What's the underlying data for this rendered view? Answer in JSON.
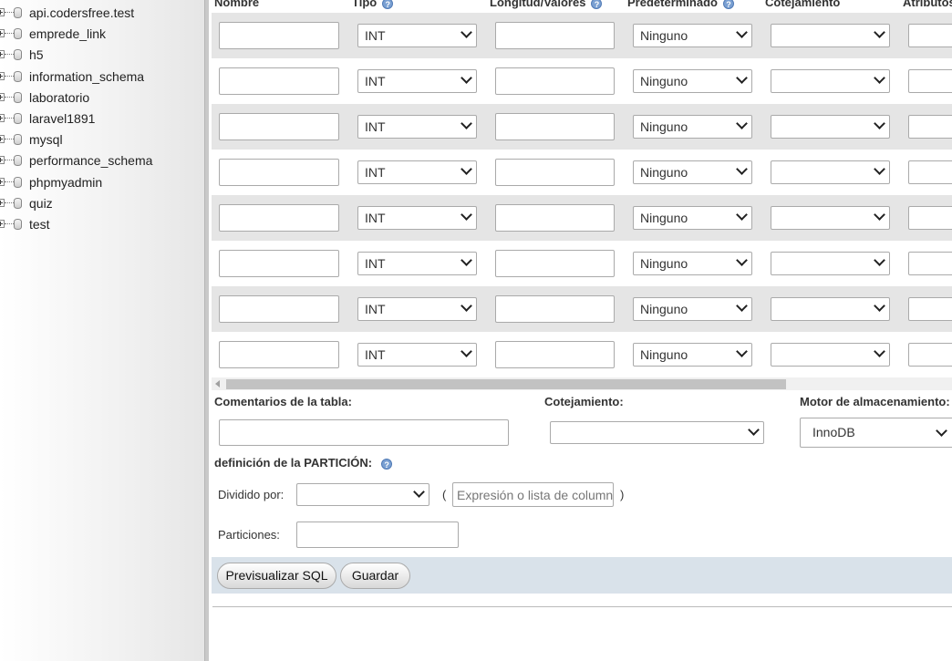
{
  "sidebar": {
    "databases": [
      "api.codersfree.test",
      "emprede_link",
      "h5",
      "information_schema",
      "laboratorio",
      "laravel1891",
      "mysql",
      "performance_schema",
      "phpmyadmin",
      "quiz",
      "test"
    ]
  },
  "columns": {
    "name": "Nombre",
    "type": "Tipo",
    "length": "Longitud/Valores",
    "default": "Predeterminado",
    "collation": "Cotejamiento",
    "attributes": "Atributos"
  },
  "rows": [
    {
      "type": "INT",
      "default": "Ninguno"
    },
    {
      "type": "INT",
      "default": "Ninguno"
    },
    {
      "type": "INT",
      "default": "Ninguno"
    },
    {
      "type": "INT",
      "default": "Ninguno"
    },
    {
      "type": "INT",
      "default": "Ninguno"
    },
    {
      "type": "INT",
      "default": "Ninguno"
    },
    {
      "type": "INT",
      "default": "Ninguno"
    },
    {
      "type": "INT",
      "default": "Ninguno"
    }
  ],
  "table_options": {
    "comments_label": "Comentarios de la tabla:",
    "collation_label": "Cotejamiento:",
    "engine_label": "Motor de almacenamiento:",
    "engine_value": "InnoDB"
  },
  "partition": {
    "title": "definición de la PARTICIÓN:",
    "divided_by_label": "Dividido por:",
    "open_paren": "(",
    "expression_placeholder": "Expresión o lista de columnas",
    "close_paren": ")",
    "partitions_label": "Particiones:"
  },
  "buttons": {
    "preview_sql": "Previsualizar SQL",
    "save": "Guardar"
  },
  "colors": {
    "row_shade": "#e5e5e5",
    "footer_bar": "#d9e2ea",
    "help_icon": "#7aa0d2"
  }
}
